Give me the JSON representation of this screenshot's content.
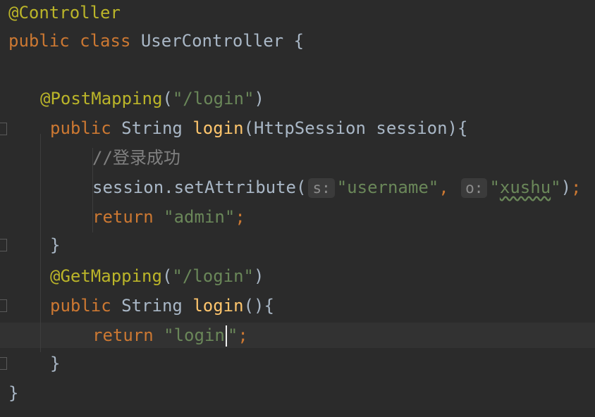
{
  "editor": {
    "lines": [
      [
        {
          "t": "@Controller",
          "c": "anno"
        }
      ],
      [
        {
          "t": "public class ",
          "c": "kw"
        },
        {
          "t": "UserController {",
          "c": "plain"
        }
      ],
      [],
      [
        {
          "t": "@PostMapping",
          "c": "anno"
        },
        {
          "t": "(",
          "c": "plain"
        },
        {
          "t": "\"/login\"",
          "c": "str"
        },
        {
          "t": ")",
          "c": "plain"
        }
      ],
      [
        {
          "t": "public ",
          "c": "kw"
        },
        {
          "t": "String ",
          "c": "plain"
        },
        {
          "t": "login",
          "c": "fn"
        },
        {
          "t": "(HttpSession session){",
          "c": "plain"
        }
      ],
      [
        {
          "t": "//登录成功",
          "c": "cmt"
        }
      ],
      [
        {
          "t": "session.setAttribute(",
          "c": "plain"
        },
        {
          "hint": "s:"
        },
        {
          "t": "\"username\"",
          "c": "str"
        },
        {
          "t": ", ",
          "c": "kw"
        },
        {
          "hint": "o:"
        },
        {
          "t": "\"",
          "c": "str"
        },
        {
          "t": "xushu",
          "c": "str typo"
        },
        {
          "t": "\"",
          "c": "str"
        },
        {
          "t": ")",
          "c": "plain"
        },
        {
          "t": ";",
          "c": "kw"
        }
      ],
      [
        {
          "t": "return ",
          "c": "kw"
        },
        {
          "t": "\"admin\"",
          "c": "str"
        },
        {
          "t": ";",
          "c": "kw"
        }
      ],
      [
        {
          "t": "}",
          "c": "plain"
        }
      ],
      [
        {
          "t": "@GetMapping",
          "c": "anno"
        },
        {
          "t": "(",
          "c": "plain"
        },
        {
          "t": "\"/login\"",
          "c": "str"
        },
        {
          "t": ")",
          "c": "plain"
        }
      ],
      [
        {
          "t": "public ",
          "c": "kw"
        },
        {
          "t": "String ",
          "c": "plain"
        },
        {
          "t": "login",
          "c": "fn"
        },
        {
          "t": "(){",
          "c": "plain"
        }
      ],
      [
        {
          "t": "return ",
          "c": "kw"
        },
        {
          "t": "\"login",
          "c": "str"
        },
        {
          "caret": true
        },
        {
          "t": "\"",
          "c": "str"
        },
        {
          "t": ";",
          "c": "kw"
        }
      ],
      [
        {
          "t": "}",
          "c": "plain"
        }
      ],
      [
        {
          "t": "}",
          "c": "plain"
        }
      ]
    ]
  }
}
